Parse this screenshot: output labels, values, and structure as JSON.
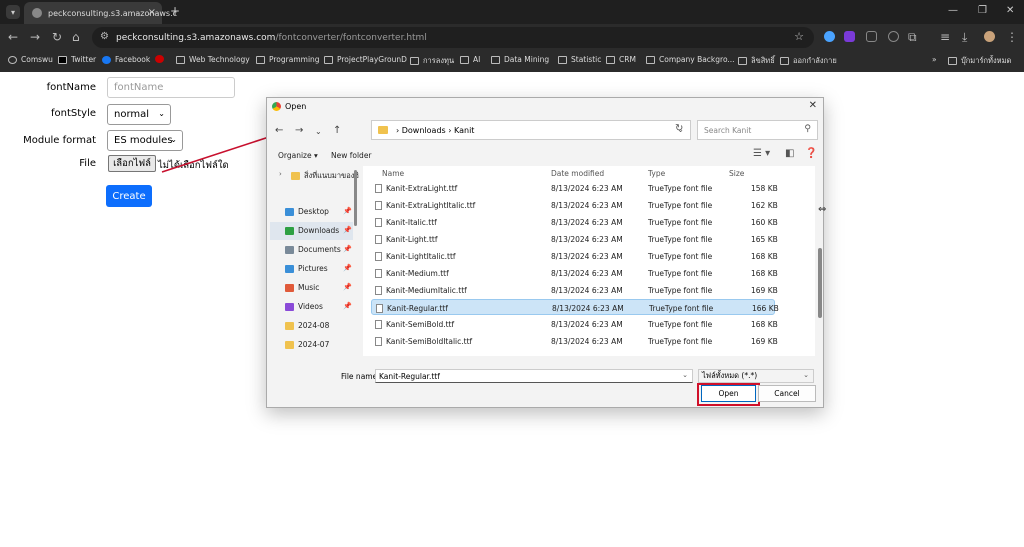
{
  "browser": {
    "tab_title": "peckconsulting.s3.amazonaws.c",
    "address_host": "peckconsulting.s3.amazonaws.com",
    "address_path": "/fontconverter/fontconverter.html",
    "bookmarks": [
      {
        "label": "Comswu"
      },
      {
        "label": "Twitter"
      },
      {
        "label": "Facebook"
      },
      {
        "label": "Web Technology"
      },
      {
        "label": "Programming"
      },
      {
        "label": "ProjectPlayGrounD"
      },
      {
        "label": "การลงทุน"
      },
      {
        "label": "AI"
      },
      {
        "label": "Data Mining"
      },
      {
        "label": "Statistic"
      },
      {
        "label": "CRM"
      },
      {
        "label": "Company Backgro..."
      },
      {
        "label": "ลิขสิทธิ์"
      },
      {
        "label": "ออกกำลังกาย"
      }
    ],
    "bookmarks_overflow": "»",
    "bookmarks_other": "บุ๊กมาร์กทั้งหมด"
  },
  "form": {
    "fontname_label": "fontName",
    "fontname_placeholder": "fontName",
    "fontstyle_label": "fontStyle",
    "fontstyle_value": "normal",
    "module_label": "Module format",
    "module_value": "ES modules",
    "file_label": "File",
    "file_button": "เลือกไฟล์",
    "file_status": "ไม่ได้เลือกไฟล์ใด",
    "create_button": "Create"
  },
  "dialog": {
    "title": "Open",
    "breadcrumb": [
      "Downloads",
      "Kanit"
    ],
    "search_placeholder": "Search Kanit",
    "organize": "Organize",
    "new_folder": "New folder",
    "nav_items": [
      {
        "label": "สิ่งที่แนบมาของฮิ",
        "color": "#f0c24e"
      },
      {
        "label": "Desktop",
        "color": "#3a8fd8"
      },
      {
        "label": "Downloads",
        "color": "#2ea043"
      },
      {
        "label": "Documents",
        "color": "#7a8a99"
      },
      {
        "label": "Pictures",
        "color": "#3a8fd8"
      },
      {
        "label": "Music",
        "color": "#e05a3a"
      },
      {
        "label": "Videos",
        "color": "#8a4ad8"
      },
      {
        "label": "2024-08",
        "color": "#f0c24e"
      },
      {
        "label": "2024-07",
        "color": "#f0c24e"
      }
    ],
    "columns": {
      "name": "Name",
      "date": "Date modified",
      "type": "Type",
      "size": "Size"
    },
    "files": [
      {
        "name": "Kanit-ExtraLight.ttf",
        "date": "8/13/2024 6:23 AM",
        "type": "TrueType font file",
        "size": "158 KB"
      },
      {
        "name": "Kanit-ExtraLightItalic.ttf",
        "date": "8/13/2024 6:23 AM",
        "type": "TrueType font file",
        "size": "162 KB"
      },
      {
        "name": "Kanit-Italic.ttf",
        "date": "8/13/2024 6:23 AM",
        "type": "TrueType font file",
        "size": "160 KB"
      },
      {
        "name": "Kanit-Light.ttf",
        "date": "8/13/2024 6:23 AM",
        "type": "TrueType font file",
        "size": "165 KB"
      },
      {
        "name": "Kanit-LightItalic.ttf",
        "date": "8/13/2024 6:23 AM",
        "type": "TrueType font file",
        "size": "168 KB"
      },
      {
        "name": "Kanit-Medium.ttf",
        "date": "8/13/2024 6:23 AM",
        "type": "TrueType font file",
        "size": "168 KB"
      },
      {
        "name": "Kanit-MediumItalic.ttf",
        "date": "8/13/2024 6:23 AM",
        "type": "TrueType font file",
        "size": "169 KB"
      },
      {
        "name": "Kanit-Regular.ttf",
        "date": "8/13/2024 6:23 AM",
        "type": "TrueType font file",
        "size": "166 KB"
      },
      {
        "name": "Kanit-SemiBold.ttf",
        "date": "8/13/2024 6:23 AM",
        "type": "TrueType font file",
        "size": "168 KB"
      },
      {
        "name": "Kanit-SemiBoldItalic.ttf",
        "date": "8/13/2024 6:23 AM",
        "type": "TrueType font file",
        "size": "169 KB"
      }
    ],
    "selected_file": "Kanit-Regular.ttf",
    "filename_label": "File name:",
    "filename_value": "Kanit-Regular.ttf",
    "filetype_value": "ไฟล์ทั้งหมด (*.*)",
    "open_button": "Open",
    "cancel_button": "Cancel"
  },
  "colors": {
    "accent": "#0d6efd",
    "highlight": "#d0102a",
    "selection": "#cce4f7"
  }
}
